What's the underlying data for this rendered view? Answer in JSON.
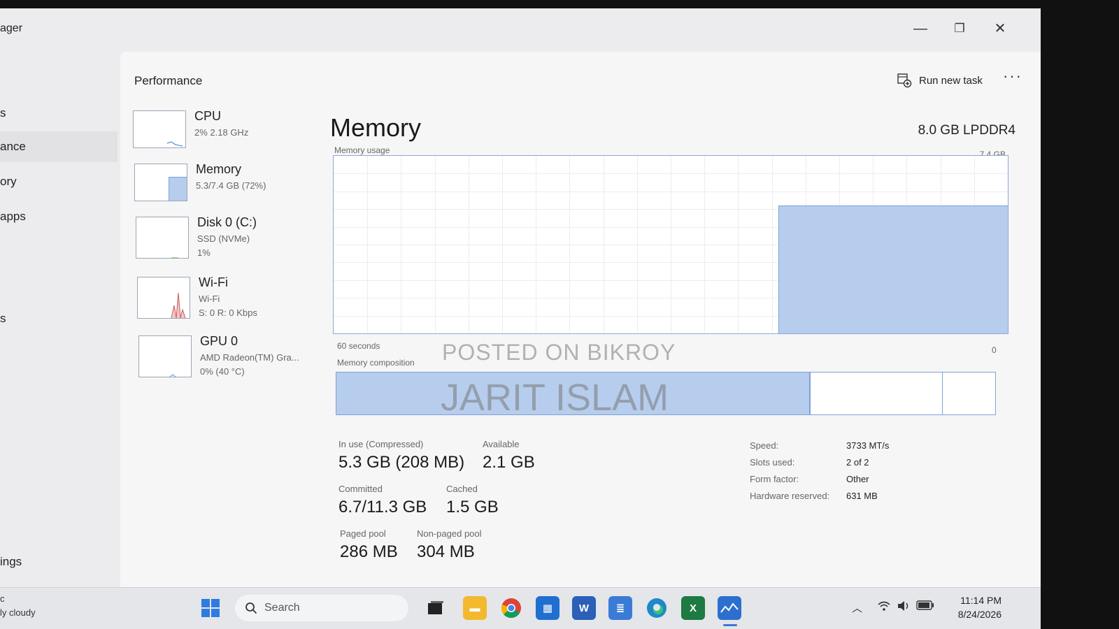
{
  "window": {
    "title_fragment": "ager",
    "controls": {
      "minimize": "—",
      "maximize": "❐",
      "close": "✕"
    }
  },
  "nav": {
    "items": [
      "s",
      "ance",
      "ory",
      "apps",
      "s",
      "ings"
    ],
    "active_index": 1
  },
  "header": {
    "title": "Performance",
    "run_new_task": "Run new task",
    "more": "···"
  },
  "resources": [
    {
      "name": "CPU",
      "line1": "2%  2.18 GHz",
      "line2": ""
    },
    {
      "name": "Memory",
      "line1": "5.3/7.4 GB (72%)",
      "line2": ""
    },
    {
      "name": "Disk 0 (C:)",
      "line1": "SSD (NVMe)",
      "line2": "1%"
    },
    {
      "name": "Wi-Fi",
      "line1": "Wi-Fi",
      "line2": "S: 0  R: 0 Kbps"
    },
    {
      "name": "GPU 0",
      "line1": "AMD Radeon(TM) Gra...",
      "line2": "0%  (40 °C)"
    }
  ],
  "memory": {
    "title": "Memory",
    "spec": "8.0 GB LPDDR4",
    "usage_label": "Memory usage",
    "max_label": "7.4 GB",
    "time_label": "60 seconds",
    "zero_label": "0",
    "composition_label": "Memory composition",
    "usage_fraction": 0.72,
    "usage_history_fraction": 0.34,
    "composition": {
      "in_use": 0.72,
      "standby": 0.2,
      "free": 0.08
    },
    "stats": {
      "in_use_label": "In use (Compressed)",
      "in_use_value": "5.3 GB (208 MB)",
      "available_label": "Available",
      "available_value": "2.1 GB",
      "committed_label": "Committed",
      "committed_value": "6.7/11.3 GB",
      "cached_label": "Cached",
      "cached_value": "1.5 GB",
      "paged_label": "Paged pool",
      "paged_value": "286 MB",
      "nonpaged_label": "Non-paged pool",
      "nonpaged_value": "304 MB"
    },
    "details": [
      {
        "key": "Speed:",
        "value": "3733 MT/s"
      },
      {
        "key": "Slots used:",
        "value": "2 of 2"
      },
      {
        "key": "Form factor:",
        "value": "Other"
      },
      {
        "key": "Hardware reserved:",
        "value": "631 MB"
      }
    ]
  },
  "watermark": {
    "line1": "POSTED ON BIKROY",
    "line2": "JARIT ISLAM"
  },
  "taskbar": {
    "weather_line1": "c",
    "weather_line2": "ly cloudy",
    "search_placeholder": "Search",
    "time": "11:14 PM",
    "date": "8/24/2026"
  },
  "colors": {
    "accent": "#3b78d8",
    "memory_fill": "#b7cdee",
    "memory_border": "#7fa2d8"
  }
}
